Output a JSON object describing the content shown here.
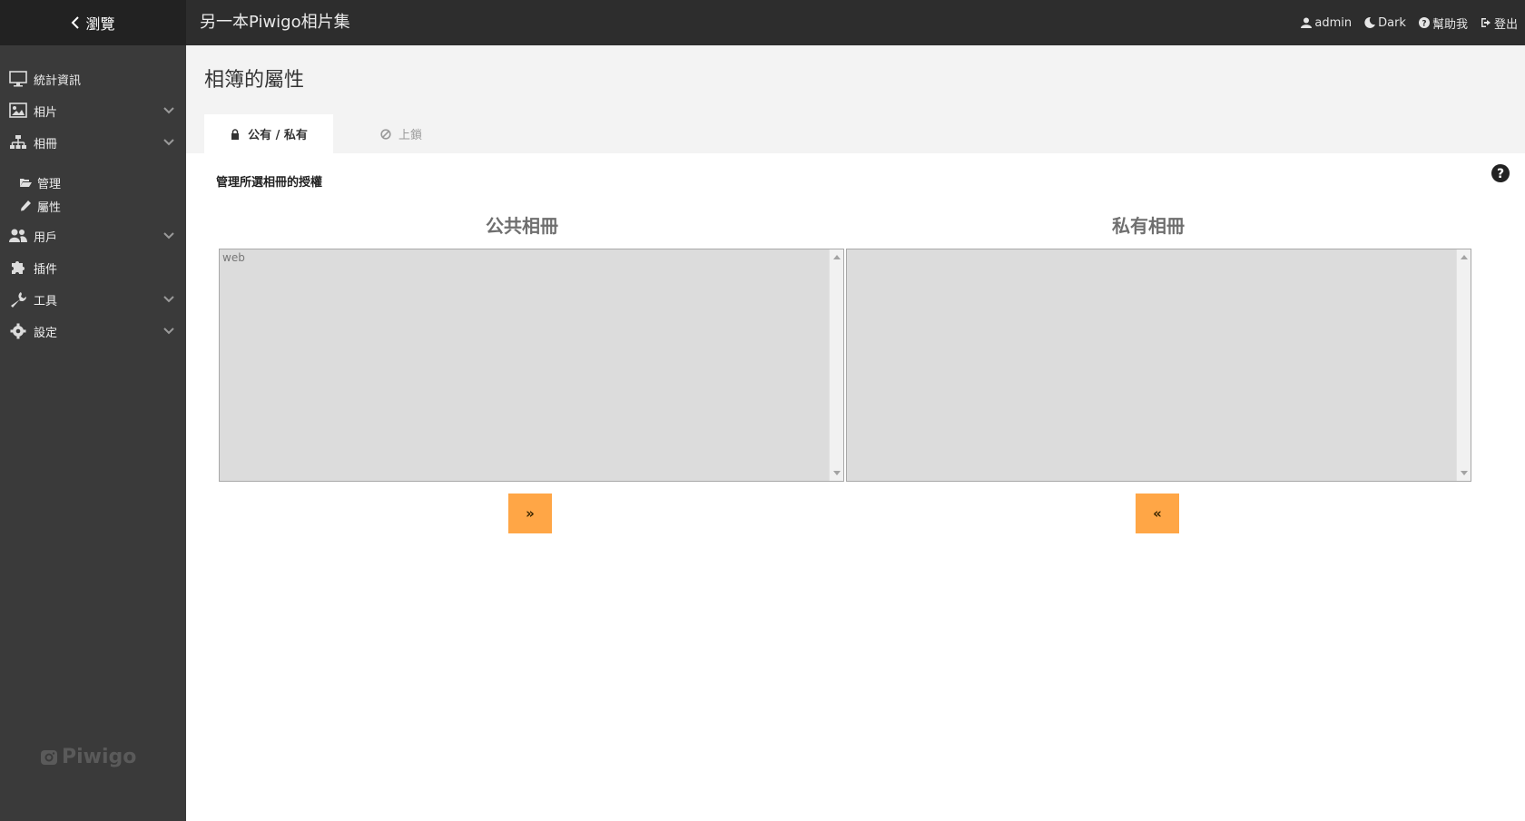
{
  "topbar": {
    "browse_label": "瀏覽",
    "gallery_title": "另一本Piwigo相片集",
    "actions": {
      "user": "admin",
      "theme": "Dark",
      "help": "幫助我",
      "logout": "登出"
    }
  },
  "sidebar": {
    "items": [
      {
        "label": "統計資訊",
        "icon": "monitor-icon"
      },
      {
        "label": "相片",
        "icon": "image-icon"
      },
      {
        "label": "相冊",
        "icon": "sitemap-icon"
      },
      {
        "label": "用戶",
        "icon": "users-icon"
      },
      {
        "label": "插件",
        "icon": "puzzle-icon"
      },
      {
        "label": "工具",
        "icon": "wrench-icon"
      },
      {
        "label": "設定",
        "icon": "gear-icon"
      }
    ],
    "subitems": [
      {
        "label": "管理",
        "icon": "folder-open-icon"
      },
      {
        "label": "屬性",
        "icon": "pencil-icon"
      }
    ],
    "logo_text": "Piwigo"
  },
  "page": {
    "title": "相簿的屬性",
    "tabs": [
      {
        "label": "公有 / 私有",
        "active": true
      },
      {
        "label": "上鎖",
        "active": false
      }
    ],
    "section_label": "管理所選相冊的授權",
    "public_title": "公共相冊",
    "private_title": "私有相冊",
    "public_list": [
      "web"
    ],
    "private_list": [],
    "move_to_private": "»",
    "move_to_public": "«"
  },
  "colors": {
    "topbar": "#2d2d2d",
    "sidebar": "#3a3a3a",
    "accent": "#ffa646",
    "listbox": "#dcdcdc"
  }
}
